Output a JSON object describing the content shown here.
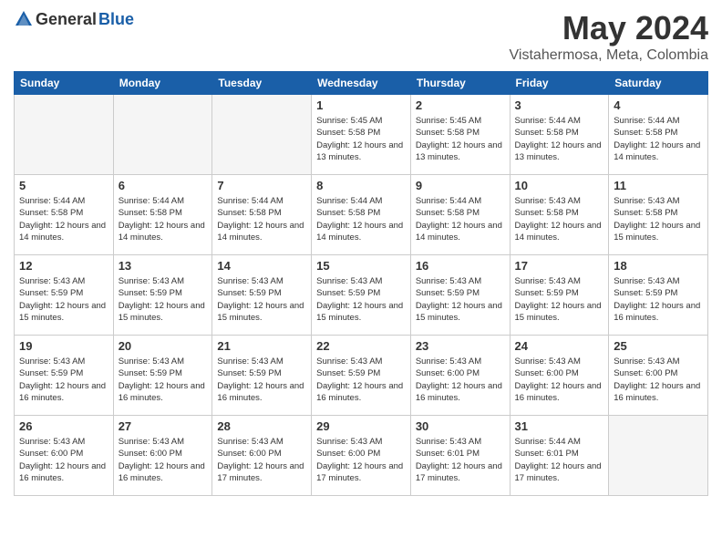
{
  "header": {
    "logo_general": "General",
    "logo_blue": "Blue",
    "month_year": "May 2024",
    "location": "Vistahermosa, Meta, Colombia"
  },
  "days_of_week": [
    "Sunday",
    "Monday",
    "Tuesday",
    "Wednesday",
    "Thursday",
    "Friday",
    "Saturday"
  ],
  "weeks": [
    [
      {
        "day": "",
        "empty": true
      },
      {
        "day": "",
        "empty": true
      },
      {
        "day": "",
        "empty": true
      },
      {
        "day": "1",
        "sunrise": "Sunrise: 5:45 AM",
        "sunset": "Sunset: 5:58 PM",
        "daylight": "Daylight: 12 hours and 13 minutes."
      },
      {
        "day": "2",
        "sunrise": "Sunrise: 5:45 AM",
        "sunset": "Sunset: 5:58 PM",
        "daylight": "Daylight: 12 hours and 13 minutes."
      },
      {
        "day": "3",
        "sunrise": "Sunrise: 5:44 AM",
        "sunset": "Sunset: 5:58 PM",
        "daylight": "Daylight: 12 hours and 13 minutes."
      },
      {
        "day": "4",
        "sunrise": "Sunrise: 5:44 AM",
        "sunset": "Sunset: 5:58 PM",
        "daylight": "Daylight: 12 hours and 14 minutes."
      }
    ],
    [
      {
        "day": "5",
        "sunrise": "Sunrise: 5:44 AM",
        "sunset": "Sunset: 5:58 PM",
        "daylight": "Daylight: 12 hours and 14 minutes."
      },
      {
        "day": "6",
        "sunrise": "Sunrise: 5:44 AM",
        "sunset": "Sunset: 5:58 PM",
        "daylight": "Daylight: 12 hours and 14 minutes."
      },
      {
        "day": "7",
        "sunrise": "Sunrise: 5:44 AM",
        "sunset": "Sunset: 5:58 PM",
        "daylight": "Daylight: 12 hours and 14 minutes."
      },
      {
        "day": "8",
        "sunrise": "Sunrise: 5:44 AM",
        "sunset": "Sunset: 5:58 PM",
        "daylight": "Daylight: 12 hours and 14 minutes."
      },
      {
        "day": "9",
        "sunrise": "Sunrise: 5:44 AM",
        "sunset": "Sunset: 5:58 PM",
        "daylight": "Daylight: 12 hours and 14 minutes."
      },
      {
        "day": "10",
        "sunrise": "Sunrise: 5:43 AM",
        "sunset": "Sunset: 5:58 PM",
        "daylight": "Daylight: 12 hours and 14 minutes."
      },
      {
        "day": "11",
        "sunrise": "Sunrise: 5:43 AM",
        "sunset": "Sunset: 5:58 PM",
        "daylight": "Daylight: 12 hours and 15 minutes."
      }
    ],
    [
      {
        "day": "12",
        "sunrise": "Sunrise: 5:43 AM",
        "sunset": "Sunset: 5:59 PM",
        "daylight": "Daylight: 12 hours and 15 minutes."
      },
      {
        "day": "13",
        "sunrise": "Sunrise: 5:43 AM",
        "sunset": "Sunset: 5:59 PM",
        "daylight": "Daylight: 12 hours and 15 minutes."
      },
      {
        "day": "14",
        "sunrise": "Sunrise: 5:43 AM",
        "sunset": "Sunset: 5:59 PM",
        "daylight": "Daylight: 12 hours and 15 minutes."
      },
      {
        "day": "15",
        "sunrise": "Sunrise: 5:43 AM",
        "sunset": "Sunset: 5:59 PM",
        "daylight": "Daylight: 12 hours and 15 minutes."
      },
      {
        "day": "16",
        "sunrise": "Sunrise: 5:43 AM",
        "sunset": "Sunset: 5:59 PM",
        "daylight": "Daylight: 12 hours and 15 minutes."
      },
      {
        "day": "17",
        "sunrise": "Sunrise: 5:43 AM",
        "sunset": "Sunset: 5:59 PM",
        "daylight": "Daylight: 12 hours and 15 minutes."
      },
      {
        "day": "18",
        "sunrise": "Sunrise: 5:43 AM",
        "sunset": "Sunset: 5:59 PM",
        "daylight": "Daylight: 12 hours and 16 minutes."
      }
    ],
    [
      {
        "day": "19",
        "sunrise": "Sunrise: 5:43 AM",
        "sunset": "Sunset: 5:59 PM",
        "daylight": "Daylight: 12 hours and 16 minutes."
      },
      {
        "day": "20",
        "sunrise": "Sunrise: 5:43 AM",
        "sunset": "Sunset: 5:59 PM",
        "daylight": "Daylight: 12 hours and 16 minutes."
      },
      {
        "day": "21",
        "sunrise": "Sunrise: 5:43 AM",
        "sunset": "Sunset: 5:59 PM",
        "daylight": "Daylight: 12 hours and 16 minutes."
      },
      {
        "day": "22",
        "sunrise": "Sunrise: 5:43 AM",
        "sunset": "Sunset: 5:59 PM",
        "daylight": "Daylight: 12 hours and 16 minutes."
      },
      {
        "day": "23",
        "sunrise": "Sunrise: 5:43 AM",
        "sunset": "Sunset: 6:00 PM",
        "daylight": "Daylight: 12 hours and 16 minutes."
      },
      {
        "day": "24",
        "sunrise": "Sunrise: 5:43 AM",
        "sunset": "Sunset: 6:00 PM",
        "daylight": "Daylight: 12 hours and 16 minutes."
      },
      {
        "day": "25",
        "sunrise": "Sunrise: 5:43 AM",
        "sunset": "Sunset: 6:00 PM",
        "daylight": "Daylight: 12 hours and 16 minutes."
      }
    ],
    [
      {
        "day": "26",
        "sunrise": "Sunrise: 5:43 AM",
        "sunset": "Sunset: 6:00 PM",
        "daylight": "Daylight: 12 hours and 16 minutes."
      },
      {
        "day": "27",
        "sunrise": "Sunrise: 5:43 AM",
        "sunset": "Sunset: 6:00 PM",
        "daylight": "Daylight: 12 hours and 16 minutes."
      },
      {
        "day": "28",
        "sunrise": "Sunrise: 5:43 AM",
        "sunset": "Sunset: 6:00 PM",
        "daylight": "Daylight: 12 hours and 17 minutes."
      },
      {
        "day": "29",
        "sunrise": "Sunrise: 5:43 AM",
        "sunset": "Sunset: 6:00 PM",
        "daylight": "Daylight: 12 hours and 17 minutes."
      },
      {
        "day": "30",
        "sunrise": "Sunrise: 5:43 AM",
        "sunset": "Sunset: 6:01 PM",
        "daylight": "Daylight: 12 hours and 17 minutes."
      },
      {
        "day": "31",
        "sunrise": "Sunrise: 5:44 AM",
        "sunset": "Sunset: 6:01 PM",
        "daylight": "Daylight: 12 hours and 17 minutes."
      },
      {
        "day": "",
        "empty": true
      }
    ]
  ]
}
